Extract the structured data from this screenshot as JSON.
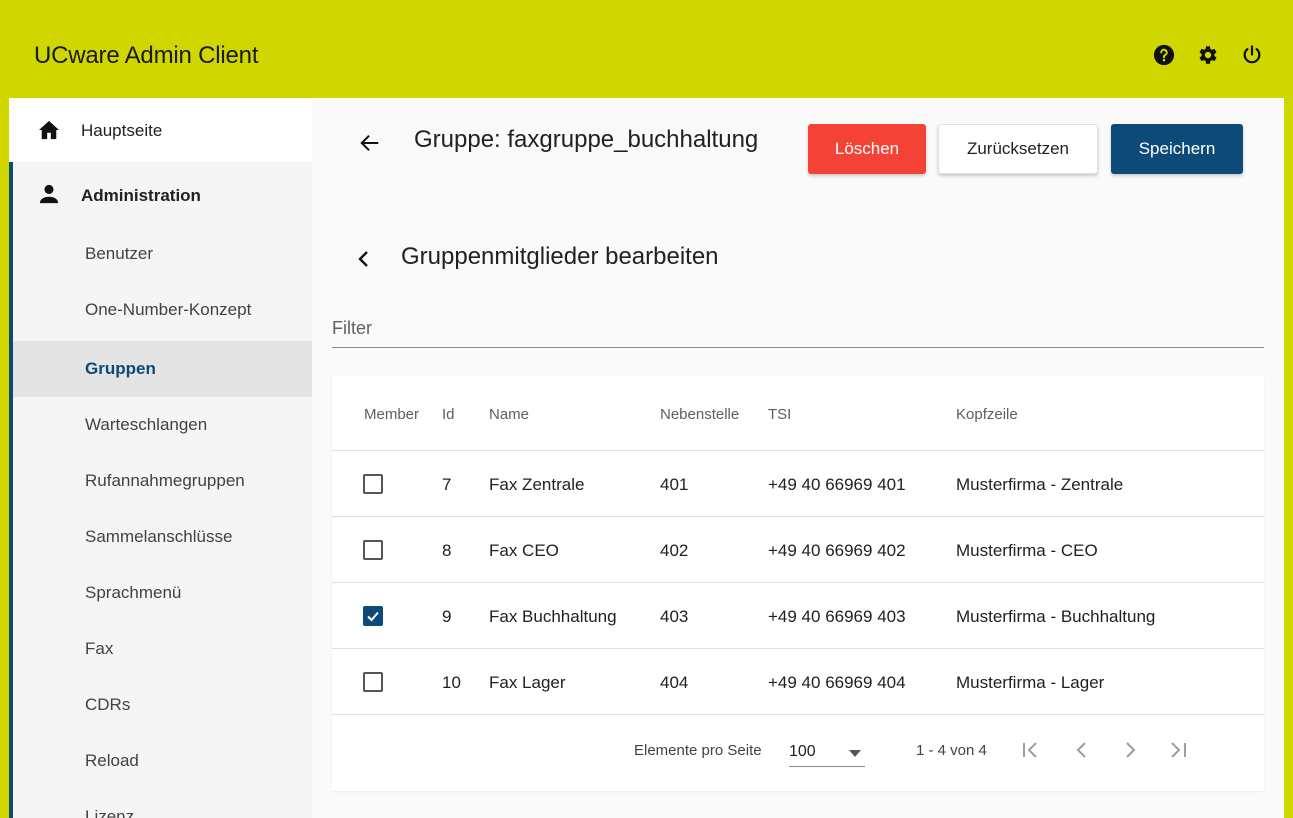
{
  "app": {
    "title": "UCware Admin Client"
  },
  "header_icons": [
    "help-icon",
    "gear-icon",
    "power-icon"
  ],
  "sidebar": {
    "home": "Hauptseite",
    "admin": "Administration",
    "items": [
      "Benutzer",
      "One-Number-Konzept",
      "Gruppen",
      "Warteschlangen",
      "Rufannahmegruppen",
      "Sammelanschlüsse",
      "Sprachmenü",
      "Fax",
      "CDRs",
      "Reload",
      "Lizenz"
    ],
    "active": "Gruppen"
  },
  "page": {
    "title": "Gruppe: faxgruppe_buchhaltung",
    "subtitle": "Gruppenmitglieder bearbeiten",
    "filter_placeholder": "Filter"
  },
  "actions": {
    "delete": "Löschen",
    "reset": "Zurücksetzen",
    "save": "Speichern"
  },
  "table": {
    "headers": {
      "member": "Member",
      "id": "Id",
      "name": "Name",
      "ext": "Nebenstelle",
      "tsi": "TSI",
      "header": "Kopfzeile"
    },
    "rows": [
      {
        "member": false,
        "id": "7",
        "name": "Fax Zentrale",
        "ext": "401",
        "tsi": "+49 40 66969 401",
        "header": "Musterfirma - Zentrale"
      },
      {
        "member": false,
        "id": "8",
        "name": "Fax CEO",
        "ext": "402",
        "tsi": "+49 40 66969 402",
        "header": "Musterfirma - CEO"
      },
      {
        "member": true,
        "id": "9",
        "name": "Fax Buchhaltung",
        "ext": "403",
        "tsi": "+49 40 66969 403",
        "header": "Musterfirma - Buchhaltung"
      },
      {
        "member": false,
        "id": "10",
        "name": "Fax Lager",
        "ext": "404",
        "tsi": "+49 40 66969 404",
        "header": "Musterfirma - Lager"
      }
    ]
  },
  "pagination": {
    "label": "Elemente pro Seite",
    "page_size": "100",
    "range": "1 - 4 von 4"
  },
  "colors": {
    "topbar": "#cfd600",
    "primary": "#0d4a78",
    "danger": "#f44336"
  }
}
